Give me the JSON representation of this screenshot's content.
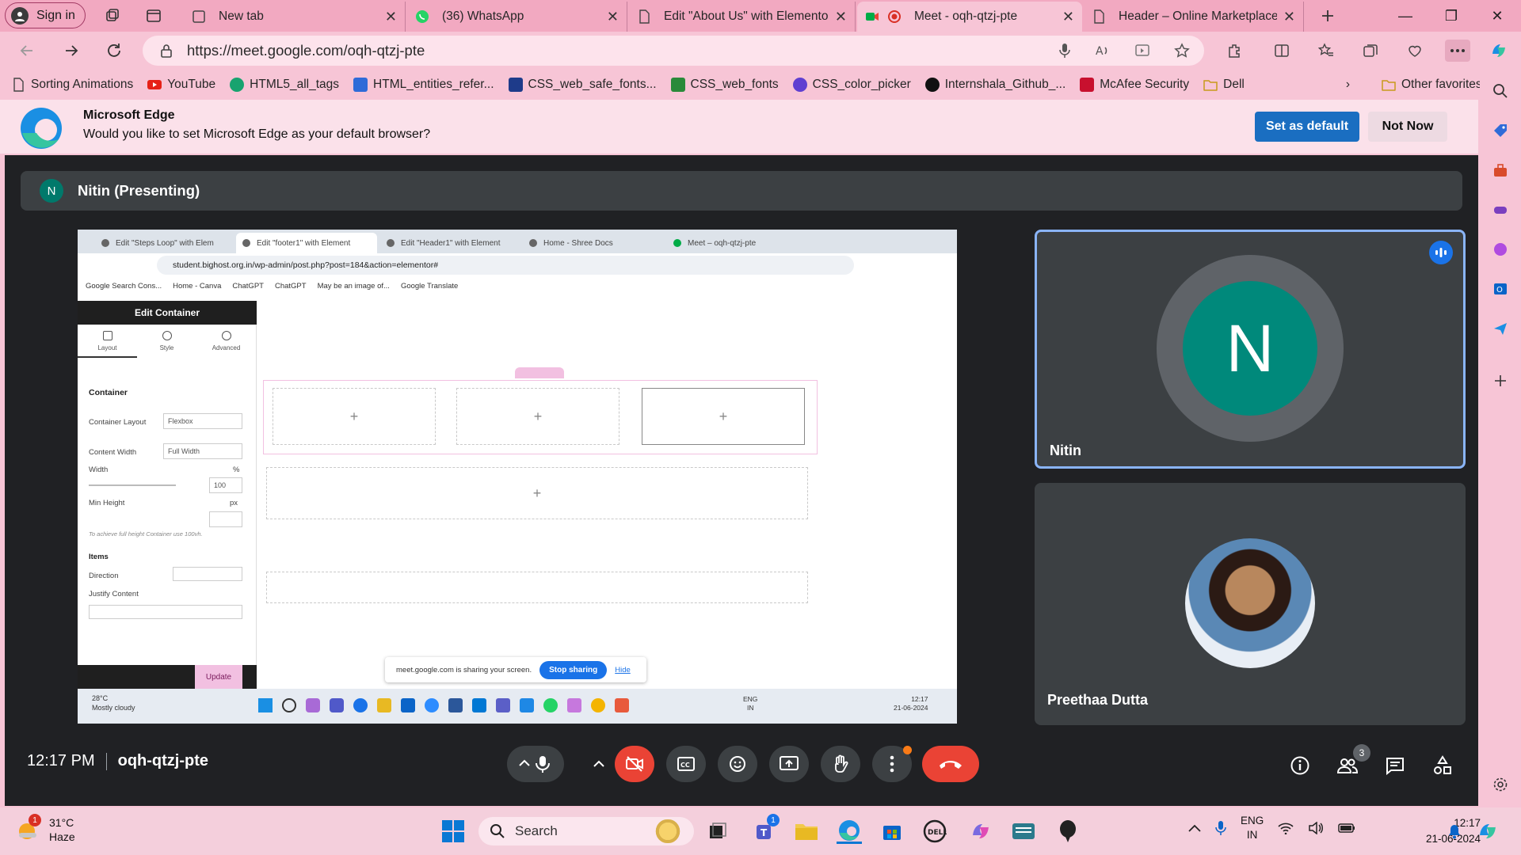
{
  "browser": {
    "profile_label": "Sign in",
    "tabs": [
      {
        "title": "New tab"
      },
      {
        "title": "(36) WhatsApp"
      },
      {
        "title": "Edit \"About Us\" with Elemento"
      },
      {
        "title": "Meet - oqh-qtzj-pte"
      },
      {
        "title": "Header – Online Marketplace"
      }
    ],
    "url": "https://meet.google.com/oqh-qtzj-pte",
    "bookmarks": [
      {
        "label": "Sorting Animations",
        "color": "#222222"
      },
      {
        "label": "YouTube",
        "color": "#e62117"
      },
      {
        "label": "HTML5_all_tags",
        "color": "#18a36f"
      },
      {
        "label": "HTML_entities_refer...",
        "color": "#2f6bd8"
      },
      {
        "label": "CSS_web_safe_fonts...",
        "color": "#1e3b8a"
      },
      {
        "label": "CSS_web_fonts",
        "color": "#2a8a3a"
      },
      {
        "label": "CSS_color_picker",
        "color": "#5f3fd1"
      },
      {
        "label": "Internshala_Github_...",
        "color": "#111111"
      },
      {
        "label": "McAfee Security",
        "color": "#c8102e"
      },
      {
        "label": "Dell",
        "color": "#e8b923"
      }
    ],
    "other_favorites": "Other favorites"
  },
  "infobar": {
    "title": "Microsoft Edge",
    "message": "Would you like to set Microsoft Edge as your default browser?",
    "primary_button": "Set as default",
    "secondary_button": "Not Now"
  },
  "meet": {
    "presenter_initial": "N",
    "presenter_label": "Nitin (Presenting)",
    "participants": [
      {
        "name": "Nitin",
        "initial": "N"
      },
      {
        "name": "Preethaa Dutta"
      }
    ],
    "time": "12:17 PM",
    "meeting_code": "oqh-qtzj-pte",
    "participant_count": "3"
  },
  "shared_screen": {
    "tabs": [
      "Edit \"Steps Loop\" with Elem",
      "Edit \"footer1\" with Element",
      "Edit \"Header1\" with Element",
      "Home - Shree Docs",
      "Meet – oqh-qtzj-pte"
    ],
    "url": "student.bighost.org.in/wp-admin/post.php?post=184&action=elementor#",
    "bookmarks": [
      "Google Search Cons...",
      "Home - Canva",
      "ChatGPT",
      "ChatGPT",
      "May be an image of...",
      "Google Translate"
    ],
    "panel_title": "Edit Container",
    "panel_tabs": [
      "Layout",
      "Style",
      "Advanced"
    ],
    "section": "Container",
    "fields": {
      "layout_label": "Container Layout",
      "layout_value": "Flexbox",
      "width_label": "Content Width",
      "width_value": "Full Width",
      "w_label": "Width",
      "w_unit": "%",
      "w_value": "100",
      "minh_label": "Min Height",
      "minh_unit": "px",
      "hint": "To achieve full height Container use 100vh.",
      "items": "Items",
      "direction": "Direction",
      "justify": "Justify Content"
    },
    "update_label": "Update",
    "share_msg": "meet.google.com is sharing your screen.",
    "stop_sharing": "Stop sharing",
    "hide": "Hide",
    "weather": {
      "temp": "28°C",
      "cond": "Mostly cloudy"
    },
    "tray": {
      "lang1": "ENG",
      "lang2": "IN",
      "time": "12:17",
      "date": "21-06-2024"
    }
  },
  "taskbar": {
    "weather_temp": "31°C",
    "weather_cond": "Haze",
    "search_placeholder": "Search",
    "lang1": "ENG",
    "lang2": "IN",
    "time": "12:17",
    "date": "21-06-2024",
    "teams_badge": "1",
    "weather_badge": "1"
  }
}
